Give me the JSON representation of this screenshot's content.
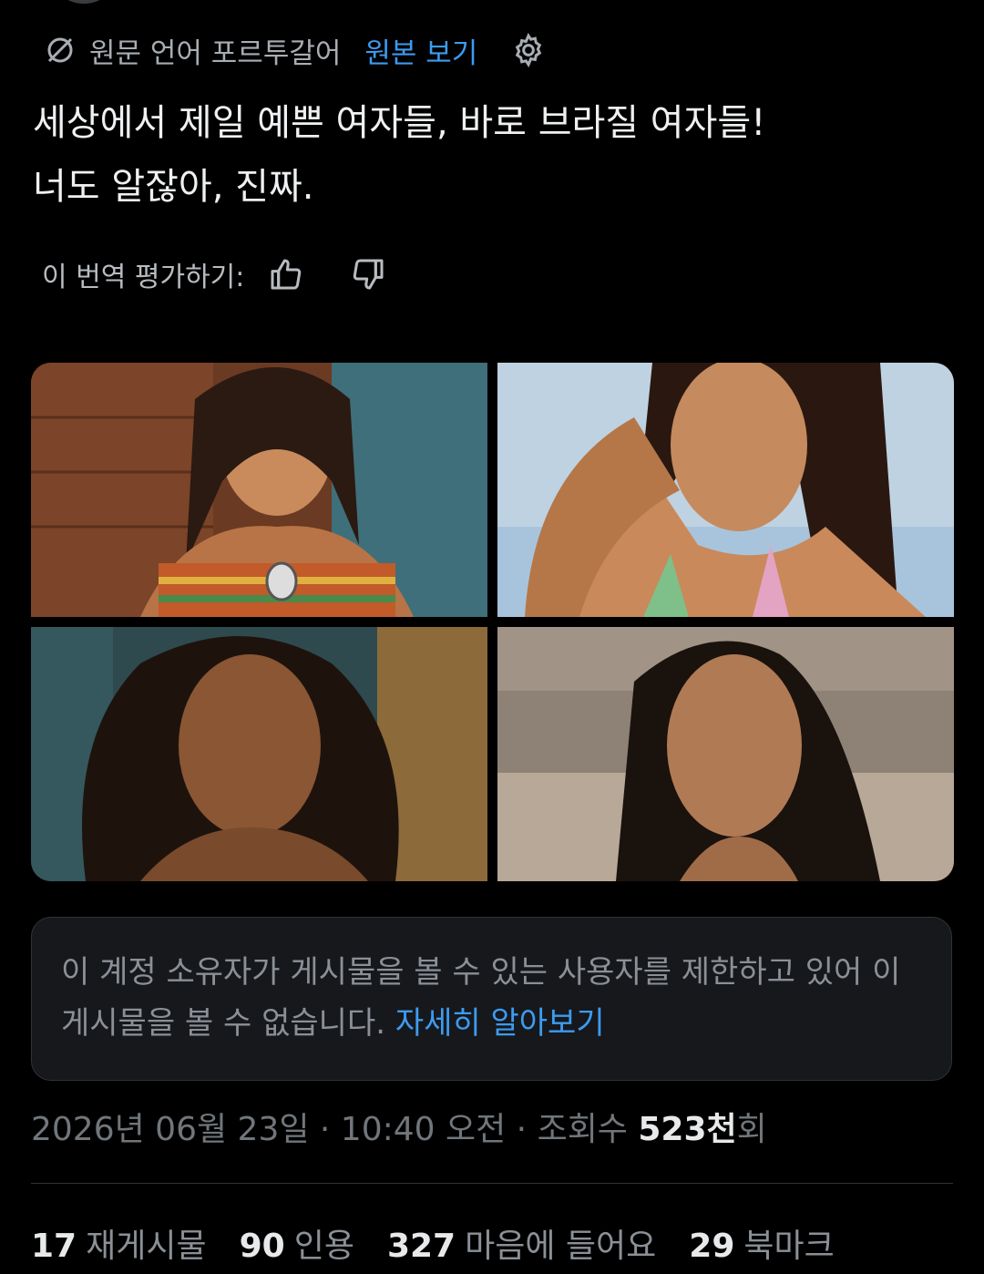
{
  "translation": {
    "source_language_label": "원문 언어 포르투갈어",
    "show_original_label": "원본 보기"
  },
  "tweet": {
    "text_line1": "세상에서 제일 예쁜 여자들, 바로 브라질 여자들!",
    "text_line2": "너도 알잖아, 진짜."
  },
  "rating": {
    "label": "이 번역 평가하기:"
  },
  "notice": {
    "text": "이 계정 소유자가 게시물을 볼 수 있는 사용자를 제한하고 있어 이 게시물을 볼 수 없습니다. ",
    "link": "자세히 알아보기"
  },
  "meta": {
    "datetime": "2026년 06월 23일 · 10:40 오전 · 조회수 ",
    "views_count": "523천",
    "views_suffix": "회"
  },
  "stats": [
    {
      "count": "17",
      "label": "재게시물"
    },
    {
      "count": "90",
      "label": "인용"
    },
    {
      "count": "327",
      "label": "마음에 들어요"
    },
    {
      "count": "29",
      "label": "북마크"
    }
  ],
  "colors": {
    "accent": "#3d9bf0",
    "background": "#000000",
    "muted_text": "#71767b"
  },
  "icons": [
    "globe-off-icon",
    "gear-icon",
    "thumbs-up-icon",
    "thumbs-down-icon"
  ]
}
